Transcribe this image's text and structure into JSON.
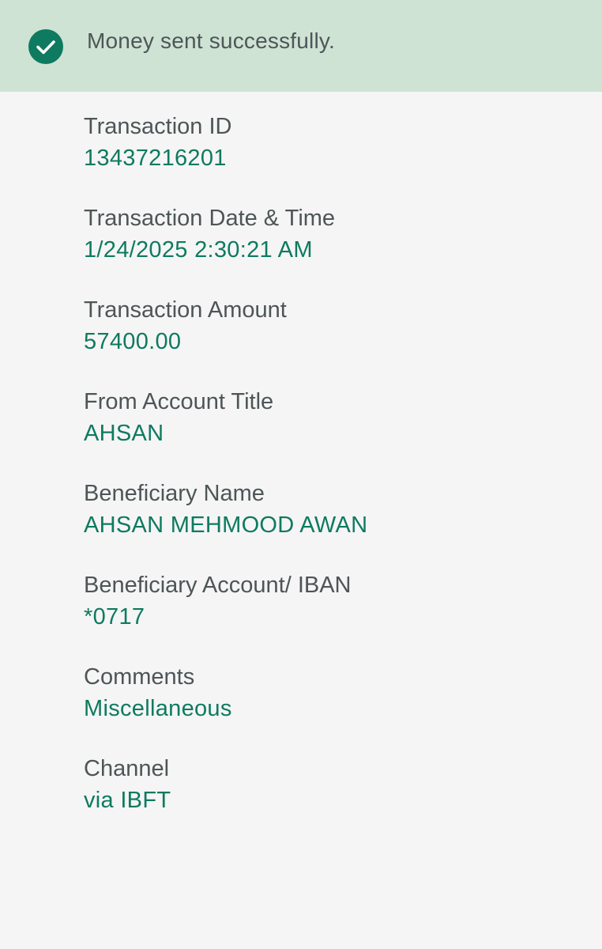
{
  "banner": {
    "message": "Money sent successfully.",
    "icon": "check-circle-icon",
    "background_color": "#cfe3d4",
    "icon_color": "#0e7a5f"
  },
  "details": [
    {
      "label": "Transaction ID",
      "value": "13437216201"
    },
    {
      "label": "Transaction Date & Time",
      "value": "1/24/2025 2:30:21 AM"
    },
    {
      "label": "Transaction Amount",
      "value": "57400.00"
    },
    {
      "label": "From Account Title",
      "value": "AHSAN"
    },
    {
      "label": "Beneficiary Name",
      "value": "AHSAN MEHMOOD AWAN"
    },
    {
      "label": "Beneficiary Account/ IBAN",
      "value": "*0717"
    },
    {
      "label": "Comments",
      "value": "Miscellaneous"
    },
    {
      "label": "Channel",
      "value": "via IBFT"
    }
  ],
  "colors": {
    "accent": "#0e7a5f",
    "label_text": "#4e5557",
    "page_background": "#f5f5f5"
  }
}
